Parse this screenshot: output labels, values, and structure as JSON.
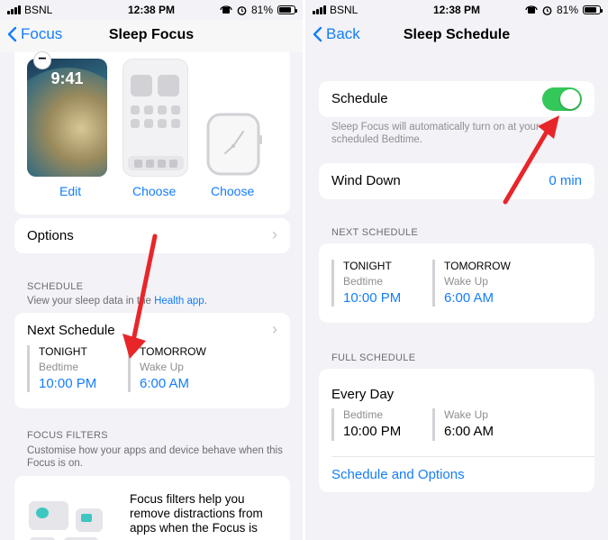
{
  "left": {
    "status": {
      "carrier": "BSNL",
      "time": "12:38 PM",
      "battery": "81%"
    },
    "nav": {
      "back_label": "Focus",
      "title": "Sleep Focus"
    },
    "gallery": {
      "lock_time": "9:41",
      "edit_label": "Edit",
      "choose_home_label": "Choose",
      "choose_watch_label": "Choose"
    },
    "options_label": "Options",
    "schedule": {
      "header": "SCHEDULE",
      "desc_prefix": "View your sleep data in the ",
      "desc_link": "Health app",
      "desc_suffix": ".",
      "next_label": "Next Schedule",
      "tonight_label": "TONIGHT",
      "bedtime_label": "Bedtime",
      "bedtime_value": "10:00 PM",
      "tomorrow_label": "TOMORROW",
      "wakeup_label": "Wake Up",
      "wakeup_value": "6:00 AM"
    },
    "filters": {
      "header": "FOCUS FILTERS",
      "desc": "Customise how your apps and device behave when this Focus is on.",
      "card_text": "Focus filters help you remove distractions from apps when the Focus is"
    }
  },
  "right": {
    "status": {
      "carrier": "BSNL",
      "time": "12:38 PM",
      "battery": "81%"
    },
    "nav": {
      "back_label": "Back",
      "title": "Sleep Schedule"
    },
    "schedule_label": "Schedule",
    "schedule_on": true,
    "schedule_note": "Sleep Focus will automatically turn on at your scheduled Bedtime.",
    "wind_down_label": "Wind Down",
    "wind_down_value": "0 min",
    "next": {
      "header": "NEXT SCHEDULE",
      "tonight_label": "TONIGHT",
      "bedtime_label": "Bedtime",
      "bedtime_value": "10:00 PM",
      "tomorrow_label": "TOMORROW",
      "wakeup_label": "Wake Up",
      "wakeup_value": "6:00 AM"
    },
    "full": {
      "header": "FULL SCHEDULE",
      "days_label": "Every Day",
      "bedtime_label": "Bedtime",
      "bedtime_value": "10:00 PM",
      "wakeup_label": "Wake Up",
      "wakeup_value": "6:00 AM",
      "options_link": "Schedule and Options"
    }
  },
  "colors": {
    "accent": "#147efb",
    "toggle_on": "#34c759",
    "arrow": "#e8262a"
  }
}
